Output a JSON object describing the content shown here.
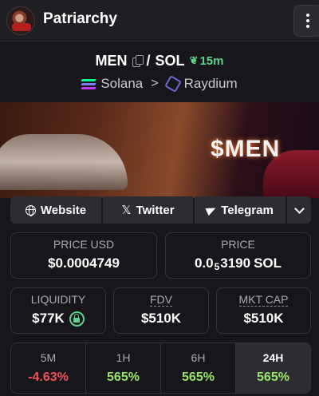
{
  "header": {
    "title": "Patriarchy"
  },
  "pair": {
    "base": "MEN",
    "separator": "/",
    "quote": "SOL",
    "age": "15m"
  },
  "chain": {
    "network": "Solana",
    "dex": "Raydium"
  },
  "banner": {
    "ticker": "$MEN"
  },
  "links": {
    "website": "Website",
    "twitter": "Twitter",
    "telegram": "Telegram"
  },
  "stats": {
    "price_usd": {
      "label": "PRICE USD",
      "value": "$0.0004749"
    },
    "price_native": {
      "label": "PRICE",
      "prefix": "0.0",
      "zeros": "5",
      "digits": "3190",
      "unit": "SOL"
    },
    "liquidity": {
      "label": "LIQUIDITY",
      "value": "$77K"
    },
    "fdv": {
      "label": "FDV",
      "value": "$510K"
    },
    "mkt_cap": {
      "label": "MKT CAP",
      "value": "$510K"
    }
  },
  "changes": [
    {
      "label": "5M",
      "value": "-4.63%",
      "trend": "negative"
    },
    {
      "label": "1H",
      "value": "565%",
      "trend": "positive"
    },
    {
      "label": "6H",
      "value": "565%",
      "trend": "positive"
    },
    {
      "label": "24H",
      "value": "565%",
      "trend": "positive",
      "active": true
    }
  ],
  "colors": {
    "positive": "#9be36a",
    "negative": "#f0505a",
    "age": "#5fd08a"
  }
}
